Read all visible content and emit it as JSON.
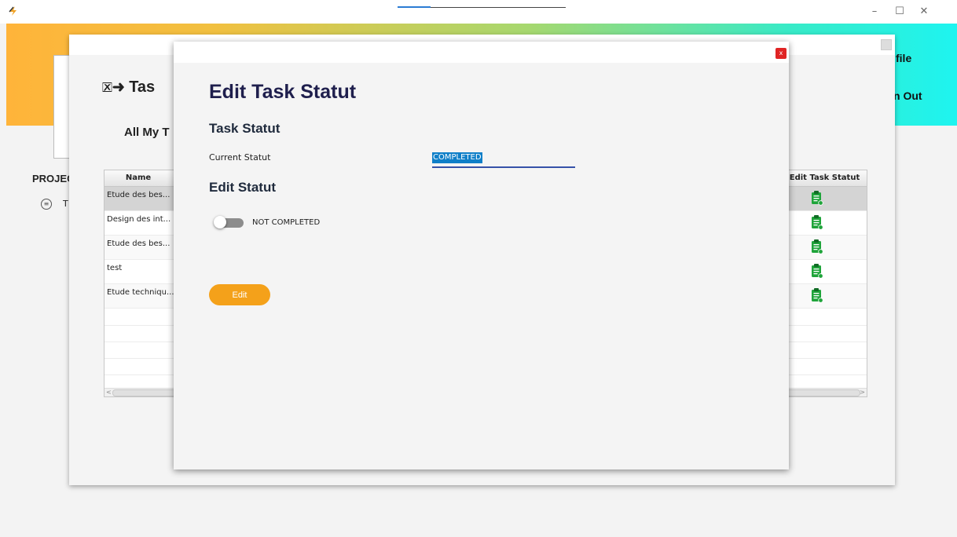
{
  "window": {
    "minimize_glyph": "–",
    "maximize_glyph": "☐",
    "close_glyph": "✕"
  },
  "header": {
    "profile_link": "file",
    "signout_link": "n Out"
  },
  "sidebar": {
    "projects_label": "PROJEC",
    "task_item_letter": "T",
    "task_item_icon": "list-circle-icon"
  },
  "page": {
    "title": "Tas",
    "title_icon": "task-arrow-icon",
    "subtitle": "All My T"
  },
  "table": {
    "columns": {
      "name": "Name",
      "edit_status": "Edit Task Statut"
    },
    "rows": [
      {
        "name": "Etude des bes..."
      },
      {
        "name": "Design des int..."
      },
      {
        "name": "Etude des bes..."
      },
      {
        "name": "test"
      },
      {
        "name": "Etude techniqu..."
      }
    ],
    "row_icon": "clipboard-check-icon",
    "scroll_left": "<",
    "scroll_right": ">"
  },
  "modal": {
    "close_label": "x",
    "title": "Edit Task Statut",
    "section_task_status": "Task Statut",
    "current_status_label": "Current Statut",
    "current_status_value": "COMPLETED",
    "section_edit_status": "Edit Statut",
    "toggle_label": "NOT COMPLETED",
    "toggle_on": false,
    "edit_button": "Edit"
  },
  "colors": {
    "accent_orange": "#f4a11a",
    "modal_title": "#1f1f4d",
    "selection_blue": "#0f7fc8",
    "close_red": "#e02424",
    "icon_green": "#1fa43a"
  }
}
